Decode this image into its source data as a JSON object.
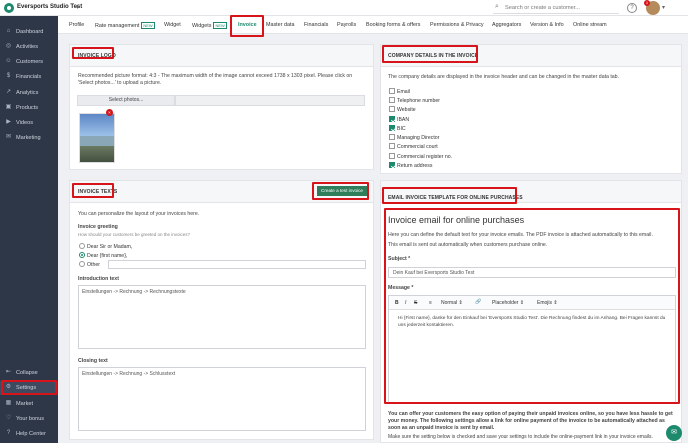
{
  "topbar": {
    "studio_name": "Eversports Studio Test",
    "search_placeholder": "Search or create a customer...",
    "help": "?",
    "notification_count": "1"
  },
  "sidebar": {
    "items": [
      {
        "label": "Dashboard",
        "icon": "home-icon"
      },
      {
        "label": "Activities",
        "icon": "activities-icon"
      },
      {
        "label": "Customers",
        "icon": "customers-icon"
      },
      {
        "label": "Financials",
        "icon": "financials-icon"
      },
      {
        "label": "Analytics",
        "icon": "analytics-icon"
      },
      {
        "label": "Products",
        "icon": "products-icon"
      },
      {
        "label": "Videos",
        "icon": "videos-icon"
      },
      {
        "label": "Marketing",
        "icon": "marketing-icon"
      }
    ],
    "bottom": [
      {
        "label": "Collapse",
        "icon": "collapse-icon"
      },
      {
        "label": "Settings",
        "icon": "gear-icon"
      },
      {
        "label": "Market",
        "icon": "market-icon"
      },
      {
        "label": "Your bonus",
        "icon": "bonus-icon"
      },
      {
        "label": "Help Center",
        "icon": "help-icon"
      }
    ]
  },
  "tabs": [
    {
      "label": "Profile"
    },
    {
      "label": "Rate management",
      "new": "NEW"
    },
    {
      "label": "Widget"
    },
    {
      "label": "Widgets",
      "new": "NEW"
    },
    {
      "label": "Invoice"
    },
    {
      "label": "Master data"
    },
    {
      "label": "Financials"
    },
    {
      "label": "Payrolls"
    },
    {
      "label": "Booking forms & offers"
    },
    {
      "label": "Permissions & Privacy"
    },
    {
      "label": "Aggregators"
    },
    {
      "label": "Version & Info"
    },
    {
      "label": "Online stream"
    }
  ],
  "logo_card": {
    "title": "INVOICE LOGO",
    "desc1": "Recommended picture format: 4:3 - The maximum width of the image cannot exceed 1738 x 1303 pixel. Please click on",
    "desc2": "'Select photos...' to upload a picture.",
    "select_button": "Select photos..."
  },
  "company_card": {
    "title": "COMPANY DETAILS IN THE INVOICE",
    "desc": "The company details are displayed in the invoice header and can be changed in the master data tab.",
    "options": [
      {
        "label": "Email",
        "checked": false
      },
      {
        "label": "Telephone number",
        "checked": false
      },
      {
        "label": "Website",
        "checked": false
      },
      {
        "label": "IBAN",
        "checked": true
      },
      {
        "label": "BIC",
        "checked": true
      },
      {
        "label": "Managing Director",
        "checked": false
      },
      {
        "label": "Commercial court",
        "checked": false
      },
      {
        "label": "Commercial register no.",
        "checked": false
      },
      {
        "label": "Return address",
        "checked": true
      }
    ]
  },
  "texts_card": {
    "title": "INVOICE TEXTS",
    "create_button": "Create a test invoice",
    "desc": "You can personalize the layout of your invoices here.",
    "greeting_label": "Invoice greeting",
    "greeting_hint": "How should your customers be greeted on the invoices?",
    "greetings": [
      {
        "label": "Dear Sir or Madam,",
        "selected": false
      },
      {
        "label": "Dear {first name},",
        "selected": true
      },
      {
        "label": "Other",
        "selected": false
      }
    ],
    "other_placeholder": "",
    "intro_label": "Introduction text",
    "intro_value": "Einstellungen -> Rechnung -> Rechnungstexte",
    "closing_label": "Closing text",
    "closing_value": "Einstellungen -> Rechnung -> Schlusstext"
  },
  "email_card": {
    "title": "EMAIL INVOICE TEMPLATE FOR ONLINE PURCHASES",
    "heading": "Invoice email for online purchases",
    "desc1": "Here you can define the default text for your invoice emails. The PDF invoice is attached automatically to this email.",
    "desc2": "This email is sent out automatically when customers purchase online.",
    "subject_label": "Subject *",
    "subject_value": "Dein Kauf bei Eversports Studio Test",
    "message_label": "Message *",
    "toolbar": {
      "bold": "B",
      "italic": "I",
      "underline": "S",
      "list": "≡",
      "normal": "Normal",
      "link": "🔗",
      "placeholder": "Placeholder",
      "emojis": "Emojis"
    },
    "message_value": "Hi {First name}, danke für den Einkauf bei 'Eversports Studio Test'. Die Rechnung findest du im Anhang. Bei Fragen kannst du uns jederzeit kontaktieren.",
    "bottom1": "You can offer your customers the easy option of paying their unpaid invoices online, so you have less hassle to get",
    "bottom2": "your money. The following settings allow a link for online payment of the invoice to be automatically attached as",
    "bottom3": "soon as an unpaid invoice is sent by email.",
    "bottom4": "Make sure the setting below is checked and save your settings to include the online-payment link in your invoice emails."
  },
  "colors": {
    "accent": "#1d8a6e",
    "highlight": "#d7141a",
    "sidebar": "#2d3748"
  }
}
